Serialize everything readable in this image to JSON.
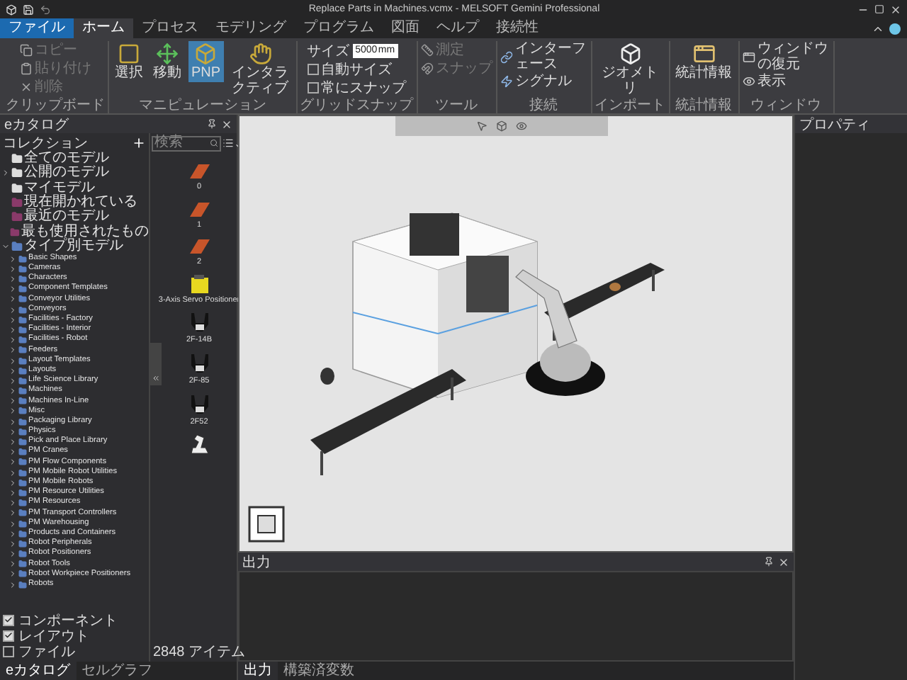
{
  "window": {
    "title": "Replace Parts in Machines.vcmx - MELSOFT Gemini Professional"
  },
  "menu_tabs": [
    {
      "label": "ファイル",
      "kind": "file",
      "selected": false
    },
    {
      "label": "ホーム",
      "kind": "tab",
      "selected": true
    },
    {
      "label": "プロセス",
      "kind": "tab",
      "selected": false
    },
    {
      "label": "モデリング",
      "kind": "tab",
      "selected": false
    },
    {
      "label": "プログラム",
      "kind": "tab",
      "selected": false
    },
    {
      "label": "図面",
      "kind": "tab",
      "selected": false
    },
    {
      "label": "ヘルプ",
      "kind": "tab",
      "selected": false
    },
    {
      "label": "接続性",
      "kind": "tab",
      "selected": false
    }
  ],
  "ribbon": [
    {
      "label": "クリップボード",
      "items": [
        {
          "kind": "small",
          "label": "コピー",
          "disabled": true
        },
        {
          "kind": "small",
          "label": "貼り付け",
          "disabled": true
        },
        {
          "kind": "small",
          "label": "削除",
          "disabled": true
        }
      ]
    },
    {
      "label": "マニピュレーション",
      "items": [
        {
          "kind": "large",
          "label": "選択",
          "disabled": false,
          "selected": false
        },
        {
          "kind": "large",
          "label": "移動",
          "disabled": false,
          "selected": false
        },
        {
          "kind": "large",
          "label": "PNP",
          "disabled": false,
          "selected": true
        },
        {
          "kind": "large",
          "label": "インタラクティブ",
          "disabled": false,
          "selected": false
        }
      ]
    },
    {
      "label": "グリッドスナップ",
      "items": [
        {
          "kind": "field",
          "label": "サイズ",
          "value": "5000",
          "unit": "mm",
          "disabled": false
        },
        {
          "kind": "check",
          "label": "自動サイズ",
          "checked": false,
          "disabled": false
        },
        {
          "kind": "check",
          "label": "常にスナップ",
          "checked": false,
          "disabled": false
        }
      ]
    },
    {
      "label": "ツール",
      "items": [
        {
          "kind": "small",
          "label": "測定",
          "disabled": true
        },
        {
          "kind": "small",
          "label": "スナップ",
          "disabled": true
        }
      ]
    },
    {
      "label": "接続",
      "items": [
        {
          "kind": "small",
          "label": "インターフェース",
          "disabled": false
        },
        {
          "kind": "small",
          "label": "シグナル",
          "disabled": false
        }
      ]
    },
    {
      "label": "インポート",
      "items": [
        {
          "kind": "large",
          "label": "ジオメトリ",
          "disabled": false,
          "selected": false
        }
      ]
    },
    {
      "label": "統計情報",
      "items": [
        {
          "kind": "large",
          "label": "統計情報",
          "disabled": false,
          "selected": false
        }
      ]
    },
    {
      "label": "ウィンドウ",
      "items": [
        {
          "kind": "small",
          "label": "ウィンドウの復元",
          "disabled": false
        },
        {
          "kind": "small",
          "label": "表示",
          "disabled": false
        }
      ]
    }
  ],
  "catalog": {
    "title": "eカタログ",
    "collections_label": "コレクション",
    "tree": [
      {
        "label": "全てのモデル",
        "kind": "all"
      },
      {
        "label": "公開のモデル",
        "kind": "folder",
        "expanded": false
      },
      {
        "label": "マイモデル",
        "kind": "folder"
      },
      {
        "label": "現在開かれている",
        "kind": "smart"
      },
      {
        "label": "最近のモデル",
        "kind": "smart"
      },
      {
        "label": "最も使用されたもの",
        "kind": "smart"
      },
      {
        "label": "タイプ別モデル",
        "kind": "type",
        "expanded": true,
        "children": [
          {
            "label": "Basic Shapes",
            "kind": "type",
            "expanded": false
          },
          {
            "label": "Cameras",
            "kind": "type",
            "expanded": false
          },
          {
            "label": "Characters",
            "kind": "type",
            "expanded": false
          },
          {
            "label": "Component Templates",
            "kind": "type",
            "expanded": false
          },
          {
            "label": "Conveyor Utilities",
            "kind": "type",
            "expanded": false
          },
          {
            "label": "Conveyors",
            "kind": "type",
            "expanded": false
          },
          {
            "label": "Facilities - Factory",
            "kind": "type",
            "expanded": false
          },
          {
            "label": "Facilities - Interior",
            "kind": "type",
            "expanded": false
          },
          {
            "label": "Facilities - Robot",
            "kind": "type",
            "expanded": false
          },
          {
            "label": "Feeders",
            "kind": "type",
            "expanded": false
          },
          {
            "label": "Layout Templates",
            "kind": "type",
            "expanded": false
          },
          {
            "label": "Layouts",
            "kind": "type",
            "expanded": false
          },
          {
            "label": "Life Science Library",
            "kind": "type",
            "expanded": false
          },
          {
            "label": "Machines",
            "kind": "type",
            "expanded": false
          },
          {
            "label": "Machines In-Line",
            "kind": "type",
            "expanded": false
          },
          {
            "label": "Misc",
            "kind": "type",
            "expanded": false
          },
          {
            "label": "Packaging Library",
            "kind": "type",
            "expanded": false
          },
          {
            "label": "Physics",
            "kind": "type",
            "expanded": false
          },
          {
            "label": "Pick and Place Library",
            "kind": "type",
            "expanded": false
          },
          {
            "label": "PM Cranes",
            "kind": "type",
            "expanded": false
          },
          {
            "label": "PM Flow Components",
            "kind": "type",
            "expanded": false
          },
          {
            "label": "PM Mobile Robot Utilities",
            "kind": "type",
            "expanded": false
          },
          {
            "label": "PM Mobile Robots",
            "kind": "type",
            "expanded": false
          },
          {
            "label": "PM Resource Utilities",
            "kind": "type",
            "expanded": false
          },
          {
            "label": "PM Resources",
            "kind": "type",
            "expanded": false
          },
          {
            "label": "PM Transport Controllers",
            "kind": "type",
            "expanded": false
          },
          {
            "label": "PM Warehousing",
            "kind": "type",
            "expanded": false
          },
          {
            "label": "Products and Containers",
            "kind": "type",
            "expanded": false
          },
          {
            "label": "Robot Peripherals",
            "kind": "type",
            "expanded": false
          },
          {
            "label": "Robot Positioners",
            "kind": "type",
            "expanded": false
          },
          {
            "label": "Robot Tools",
            "kind": "type",
            "expanded": false
          },
          {
            "label": "Robot Workpiece Positioners",
            "kind": "type",
            "expanded": false
          },
          {
            "label": "Robots",
            "kind": "type",
            "expanded": false
          }
        ]
      }
    ],
    "filters": [
      {
        "label": "コンポーネント",
        "checked": true
      },
      {
        "label": "レイアウト",
        "checked": true
      },
      {
        "label": "ファイル",
        "checked": false
      }
    ],
    "search": {
      "placeholder": "検索"
    },
    "items": [
      {
        "caption": "0",
        "kind": "digit"
      },
      {
        "caption": "1",
        "kind": "digit"
      },
      {
        "caption": "2",
        "kind": "digit"
      },
      {
        "caption": "3-Axis Servo Positioner",
        "kind": "positioner"
      },
      {
        "caption": "2F-14B",
        "kind": "gripper"
      },
      {
        "caption": "2F-85",
        "kind": "gripper"
      },
      {
        "caption": "2F52",
        "kind": "gripper"
      },
      {
        "kind": "robot"
      }
    ],
    "count": "2848 アイテム",
    "tabs": [
      {
        "label": "eカタログ",
        "selected": true
      },
      {
        "label": "セルグラフ",
        "selected": false
      }
    ]
  },
  "output": {
    "title": "出力",
    "tabs": [
      {
        "label": "出力",
        "selected": true
      },
      {
        "label": "構築済変数",
        "selected": false
      }
    ]
  },
  "properties": {
    "title": "プロパティ"
  }
}
